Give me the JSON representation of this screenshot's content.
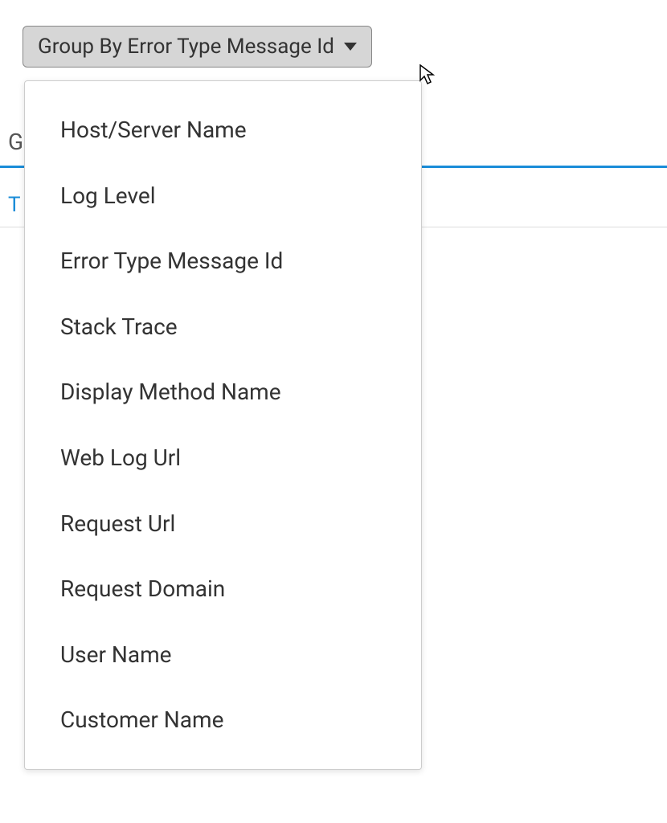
{
  "dropdown": {
    "button_label": "Group By Error Type Message Id",
    "options": [
      "Host/Server Name",
      "Log Level",
      "Error Type Message Id",
      "Stack Trace",
      "Display Method Name",
      "Web Log Url",
      "Request Url",
      "Request Domain",
      "User Name",
      "Customer Name"
    ]
  },
  "background": {
    "partial_header": "G",
    "partial_tab": "T"
  }
}
